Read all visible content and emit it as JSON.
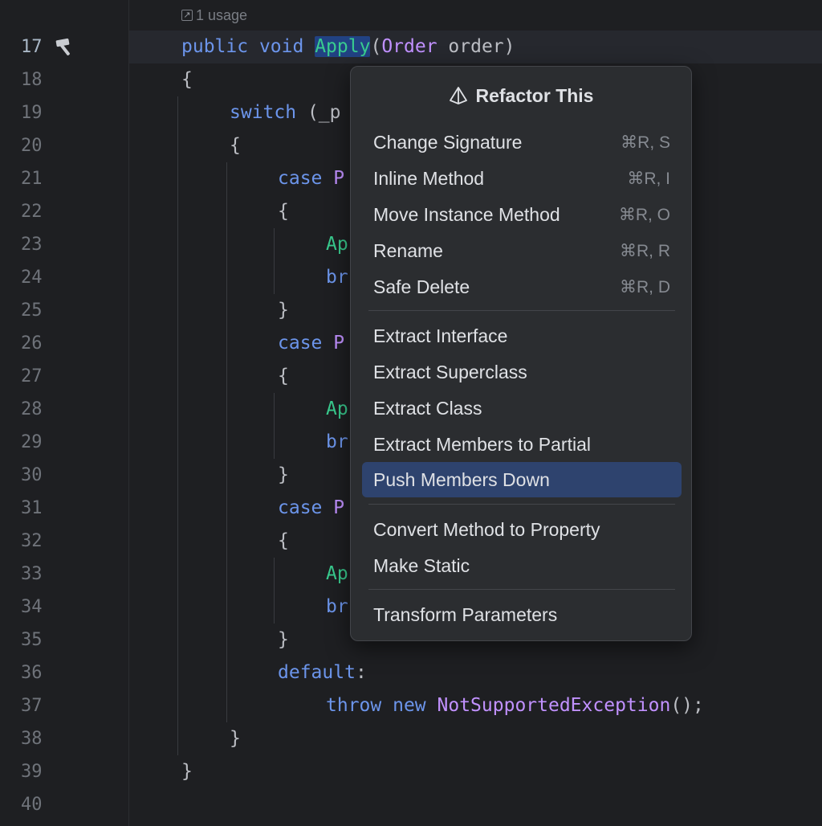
{
  "usage": {
    "label": "1 usage",
    "icon": "external-link-icon"
  },
  "gutter": {
    "lines": [
      "17",
      "18",
      "19",
      "20",
      "21",
      "22",
      "23",
      "24",
      "25",
      "26",
      "27",
      "28",
      "29",
      "30",
      "31",
      "32",
      "33",
      "34",
      "35",
      "36",
      "37",
      "38",
      "39",
      "40"
    ],
    "marker_icon": "hammer-icon"
  },
  "code": {
    "l17": {
      "t1": "public",
      "t2": "void",
      "fn": "Apply",
      "p1": "(",
      "ty": "Order",
      "rest": " order)"
    },
    "l18": "{",
    "l19": {
      "kw": "switch",
      "rest": " (_p"
    },
    "l20": "{",
    "l21": {
      "kw": "case",
      "ty": "P"
    },
    "l22": "{",
    "l23": "Ap",
    "l24": "br",
    "l25": "}",
    "l26": {
      "kw": "case",
      "ty": "P"
    },
    "l27": "{",
    "l28": "Ap",
    "l29": "br",
    "l30": "}",
    "l31": {
      "kw": "case",
      "ty": "P"
    },
    "l32": "{",
    "l33": "Ap",
    "l34": "br",
    "l35": "}",
    "l36": {
      "kw": "default",
      "rest": ":"
    },
    "l37": {
      "kw1": "throw",
      "kw2": "new",
      "ty": "NotSupportedException",
      "rest": "();"
    },
    "l38": "}",
    "l39": "}"
  },
  "popup": {
    "title": "Refactor This",
    "title_icon": "refactor-icon",
    "items": [
      {
        "label": "Change Signature",
        "shortcut": "⌘R, S"
      },
      {
        "label": "Inline Method",
        "shortcut": "⌘R, I"
      },
      {
        "label": "Move Instance Method",
        "shortcut": "⌘R, O"
      },
      {
        "label": "Rename",
        "shortcut": "⌘R, R"
      },
      {
        "label": "Safe Delete",
        "shortcut": "⌘R, D"
      },
      {
        "label": "Extract Interface",
        "shortcut": ""
      },
      {
        "label": "Extract Superclass",
        "shortcut": ""
      },
      {
        "label": "Extract Class",
        "shortcut": ""
      },
      {
        "label": "Extract Members to Partial",
        "shortcut": ""
      },
      {
        "label": "Push Members Down",
        "shortcut": "",
        "selected": true
      },
      {
        "label": "Convert Method to Property",
        "shortcut": ""
      },
      {
        "label": "Make Static",
        "shortcut": ""
      },
      {
        "label": "Transform Parameters",
        "shortcut": ""
      }
    ]
  },
  "colors": {
    "background": "#1e1f22",
    "keyword": "#6c95eb",
    "method": "#39cc8f",
    "type": "#c191ff",
    "selection": "#2e436e"
  }
}
